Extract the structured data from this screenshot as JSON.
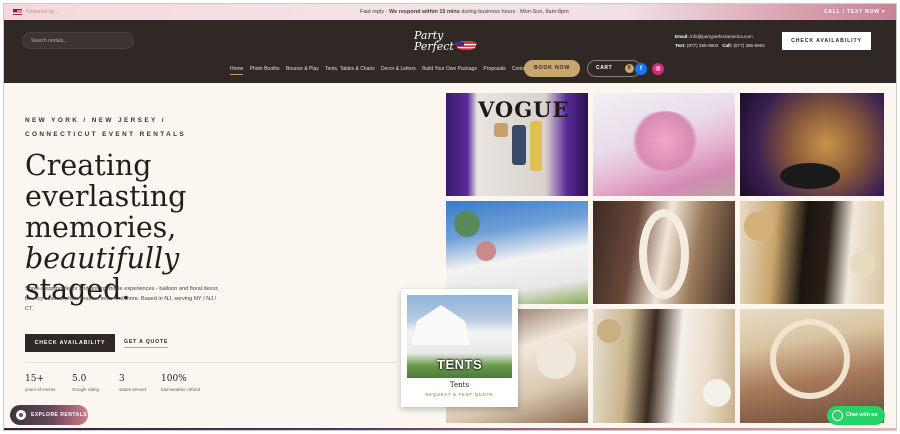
{
  "topbar": {
    "language": "Powered by ...",
    "reply_prefix": "Fast reply · ",
    "reply_bold": "We respond within 15 mins",
    "reply_suffix": " during business hours · Mon-Sun, 8am-8pm",
    "call_label": "CALL / TEXT NOW ▾"
  },
  "header": {
    "search_placeholder": "Search rentals...",
    "logo_line1": "Party",
    "logo_line2": "Perfect",
    "email_label": "Email:",
    "email_value": "info@partyperfectamerica.com",
    "text_label": "Text:",
    "text_value": "(877) 355-9904",
    "call_label": "Call:",
    "call_value": "(877) 355-9904",
    "check_availability": "CHECK AVAILABILITY",
    "nav": [
      "Home",
      "Photo Booths",
      "Bounce & Play",
      "Tents, Tables & Chairs",
      "Decor & Letters",
      "Build Your Own Package",
      "Proposals",
      "Contact"
    ],
    "book_now": "BOOK NOW",
    "cart_label": "CART",
    "cart_count": "0",
    "facebook_glyph": "f",
    "instagram_glyph": "◎"
  },
  "hero": {
    "eyebrow": "NEW YORK / NEW JERSEY / CONNECTICUT EVENT RENTALS",
    "headline_line1": "Creating",
    "headline_line2": "everlasting",
    "headline_line3": "memories,",
    "headline_italic": "beautifully",
    "headline_end": " staged.",
    "description": "Show-stopping decor and unforgettable experiences - balloon and floral decor, bouncy castles, photo booths, tents and more. Based in NJ, serving NY / NJ / CT.",
    "check_availability": "CHECK AVAILABILITY",
    "get_quote": "GET A QUOTE",
    "stats": [
      {
        "value": "15+",
        "label": "years of events"
      },
      {
        "value": "5.0",
        "label": "Google rating"
      },
      {
        "value": "3",
        "label": "states served"
      },
      {
        "value": "100%",
        "label": "bad-weather refund"
      }
    ]
  },
  "gallery": {
    "vogue_text": "VOGUE",
    "tents_card": {
      "image_label": "TENTS",
      "title": "Tents",
      "subtitle": "REQUEST A TENT QUOTE"
    }
  },
  "widgets": {
    "explore_rentals": "EXPLORE RENTALS",
    "chat": "Chat with us"
  },
  "colors": {
    "header_bg": "#2f2824",
    "accent_gold": "#c9a56f",
    "page_bg": "#fbf6f0",
    "chat_green": "#25d366"
  }
}
